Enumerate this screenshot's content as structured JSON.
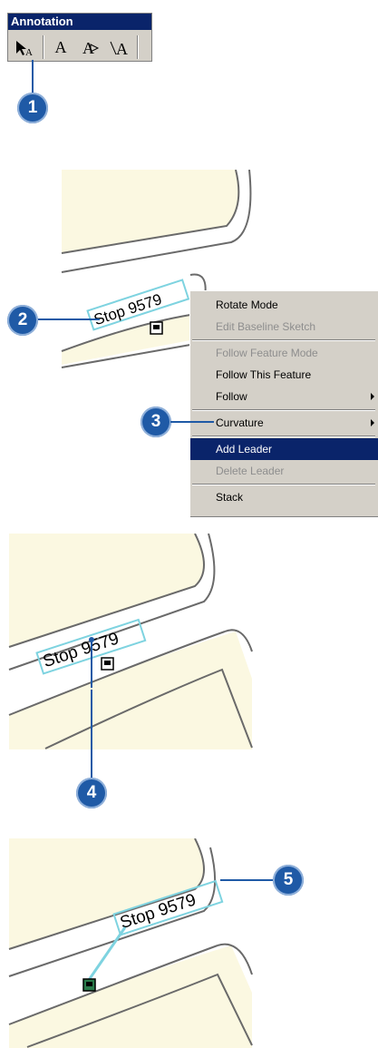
{
  "toolbar": {
    "title": "Annotation",
    "tools": [
      {
        "label": "A",
        "icon": "edit-annotation-tool-icon"
      },
      {
        "label": "A",
        "icon": "horizontal-text-icon"
      },
      {
        "label": "A",
        "icon": "straight-text-icon"
      },
      {
        "label": "A",
        "icon": "curved-text-icon"
      }
    ]
  },
  "callouts": [
    "1",
    "2",
    "3",
    "4",
    "5"
  ],
  "annotation": {
    "text": "Stop 9579"
  },
  "menu": {
    "items": [
      {
        "label": "Rotate Mode",
        "enabled": true
      },
      {
        "label": "Edit Baseline Sketch",
        "enabled": false
      },
      {
        "label": "Follow Feature Mode",
        "enabled": false
      },
      {
        "label": "Follow This Feature",
        "enabled": true
      },
      {
        "label": "Follow",
        "enabled": true,
        "submenu": true
      },
      {
        "label": "Curvature",
        "enabled": true,
        "submenu": true
      },
      {
        "label": "Add Leader",
        "enabled": true,
        "selected": true
      },
      {
        "label": "Delete Leader",
        "enabled": false
      },
      {
        "label": "Stack",
        "enabled": true
      }
    ]
  },
  "colors": {
    "accent": "#1f5aa6",
    "menu_highlight": "#0a246a",
    "parcel_fill": "#fbf8e1",
    "selection_box": "#7ed3e0"
  }
}
